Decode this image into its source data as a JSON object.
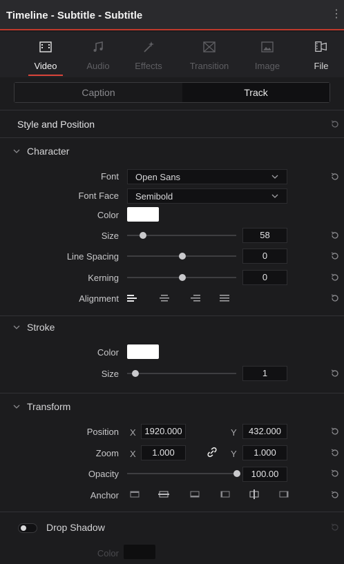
{
  "window": {
    "title": "Timeline - Subtitle - Subtitle",
    "menu_icon": "more-dots-icon"
  },
  "tabs": [
    {
      "label": "Video",
      "icon": "video-film-icon",
      "active": true
    },
    {
      "label": "Audio",
      "icon": "music-note-icon",
      "active": false
    },
    {
      "label": "Effects",
      "icon": "magic-wand-icon",
      "active": false
    },
    {
      "label": "Transition",
      "icon": "transition-icon",
      "active": false
    },
    {
      "label": "Image",
      "icon": "image-icon",
      "active": false
    },
    {
      "label": "File",
      "icon": "file-film-icon",
      "active": false
    }
  ],
  "segmented": {
    "caption": "Caption",
    "track": "Track",
    "selected": "Track"
  },
  "style_position": {
    "title": "Style and Position"
  },
  "character": {
    "title": "Character",
    "font_label": "Font",
    "font_value": "Open Sans",
    "font_face_label": "Font Face",
    "font_face_value": "Semibold",
    "color_label": "Color",
    "color_value": "#ffffff",
    "size_label": "Size",
    "size_value": "58",
    "line_spacing_label": "Line Spacing",
    "line_spacing_value": "0",
    "kerning_label": "Kerning",
    "kerning_value": "0",
    "alignment_label": "Alignment",
    "alignment_options": [
      "align-left-icon",
      "align-center-icon",
      "align-right-icon",
      "align-justify-icon"
    ],
    "alignment_selected": "align-left-icon"
  },
  "stroke": {
    "title": "Stroke",
    "color_label": "Color",
    "color_value": "#ffffff",
    "size_label": "Size",
    "size_value": "1"
  },
  "transform": {
    "title": "Transform",
    "position_label": "Position",
    "position_x": "1920.000",
    "position_y": "432.000",
    "zoom_label": "Zoom",
    "zoom_x": "1.000",
    "zoom_y": "1.000",
    "x_label": "X",
    "y_label": "Y",
    "opacity_label": "Opacity",
    "opacity_value": "100.00",
    "anchor_label": "Anchor"
  },
  "drop_shadow": {
    "title": "Drop Shadow",
    "enabled": false,
    "color_label": "Color",
    "color_value": "#0e0e0f"
  },
  "colors": {
    "accent": "#d9443a",
    "background": "#1c1c1e"
  }
}
